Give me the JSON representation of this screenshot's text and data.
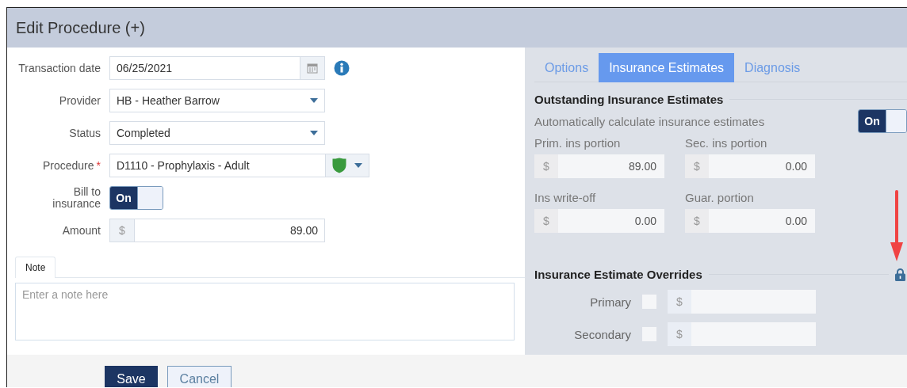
{
  "window": {
    "title": "Edit Procedure (+)"
  },
  "form": {
    "fields": [
      {
        "kind": "date",
        "label": "Transaction date",
        "value": "06/25/2021"
      },
      {
        "kind": "select",
        "label": "Provider",
        "value": "HB - Heather Barrow"
      },
      {
        "kind": "select",
        "label": "Status",
        "value": "Completed"
      },
      {
        "kind": "procedure",
        "label": "Procedure",
        "required_mark": "*",
        "value": "D1110 - Prophylaxis - Adult"
      },
      {
        "kind": "toggle",
        "label": "Bill to insurance",
        "on": true,
        "on_label": "On"
      },
      {
        "kind": "money",
        "label": "Amount",
        "prefix": "$",
        "value": "89.00"
      }
    ]
  },
  "note": {
    "tab": "Note",
    "placeholder": "Enter a note here"
  },
  "tabs": [
    {
      "label": "Options",
      "selected": false
    },
    {
      "label": "Insurance Estimates",
      "selected": true
    },
    {
      "label": "Diagnosis",
      "selected": false
    }
  ],
  "estimates": {
    "heading": "Outstanding Insurance Estimates",
    "auto": {
      "label": "Automatically calculate insurance estimates",
      "on": true,
      "on_label": "On"
    },
    "fields": [
      {
        "label": "Prim. ins portion",
        "prefix": "$",
        "value": "89.00"
      },
      {
        "label": "Sec. ins portion",
        "prefix": "$",
        "value": "0.00"
      },
      {
        "label": "Ins write-off",
        "prefix": "$",
        "value": "0.00"
      },
      {
        "label": "Guar. portion",
        "prefix": "$",
        "value": "0.00"
      }
    ]
  },
  "overrides": {
    "heading": "Insurance Estimate Overrides",
    "locked": true,
    "rows": [
      {
        "label": "Primary",
        "checked": false,
        "prefix": "$"
      },
      {
        "label": "Secondary",
        "checked": false,
        "prefix": "$"
      }
    ]
  },
  "buttons": [
    {
      "label": "Save",
      "kind": "primary"
    },
    {
      "label": "Cancel",
      "kind": "secondary"
    }
  ]
}
